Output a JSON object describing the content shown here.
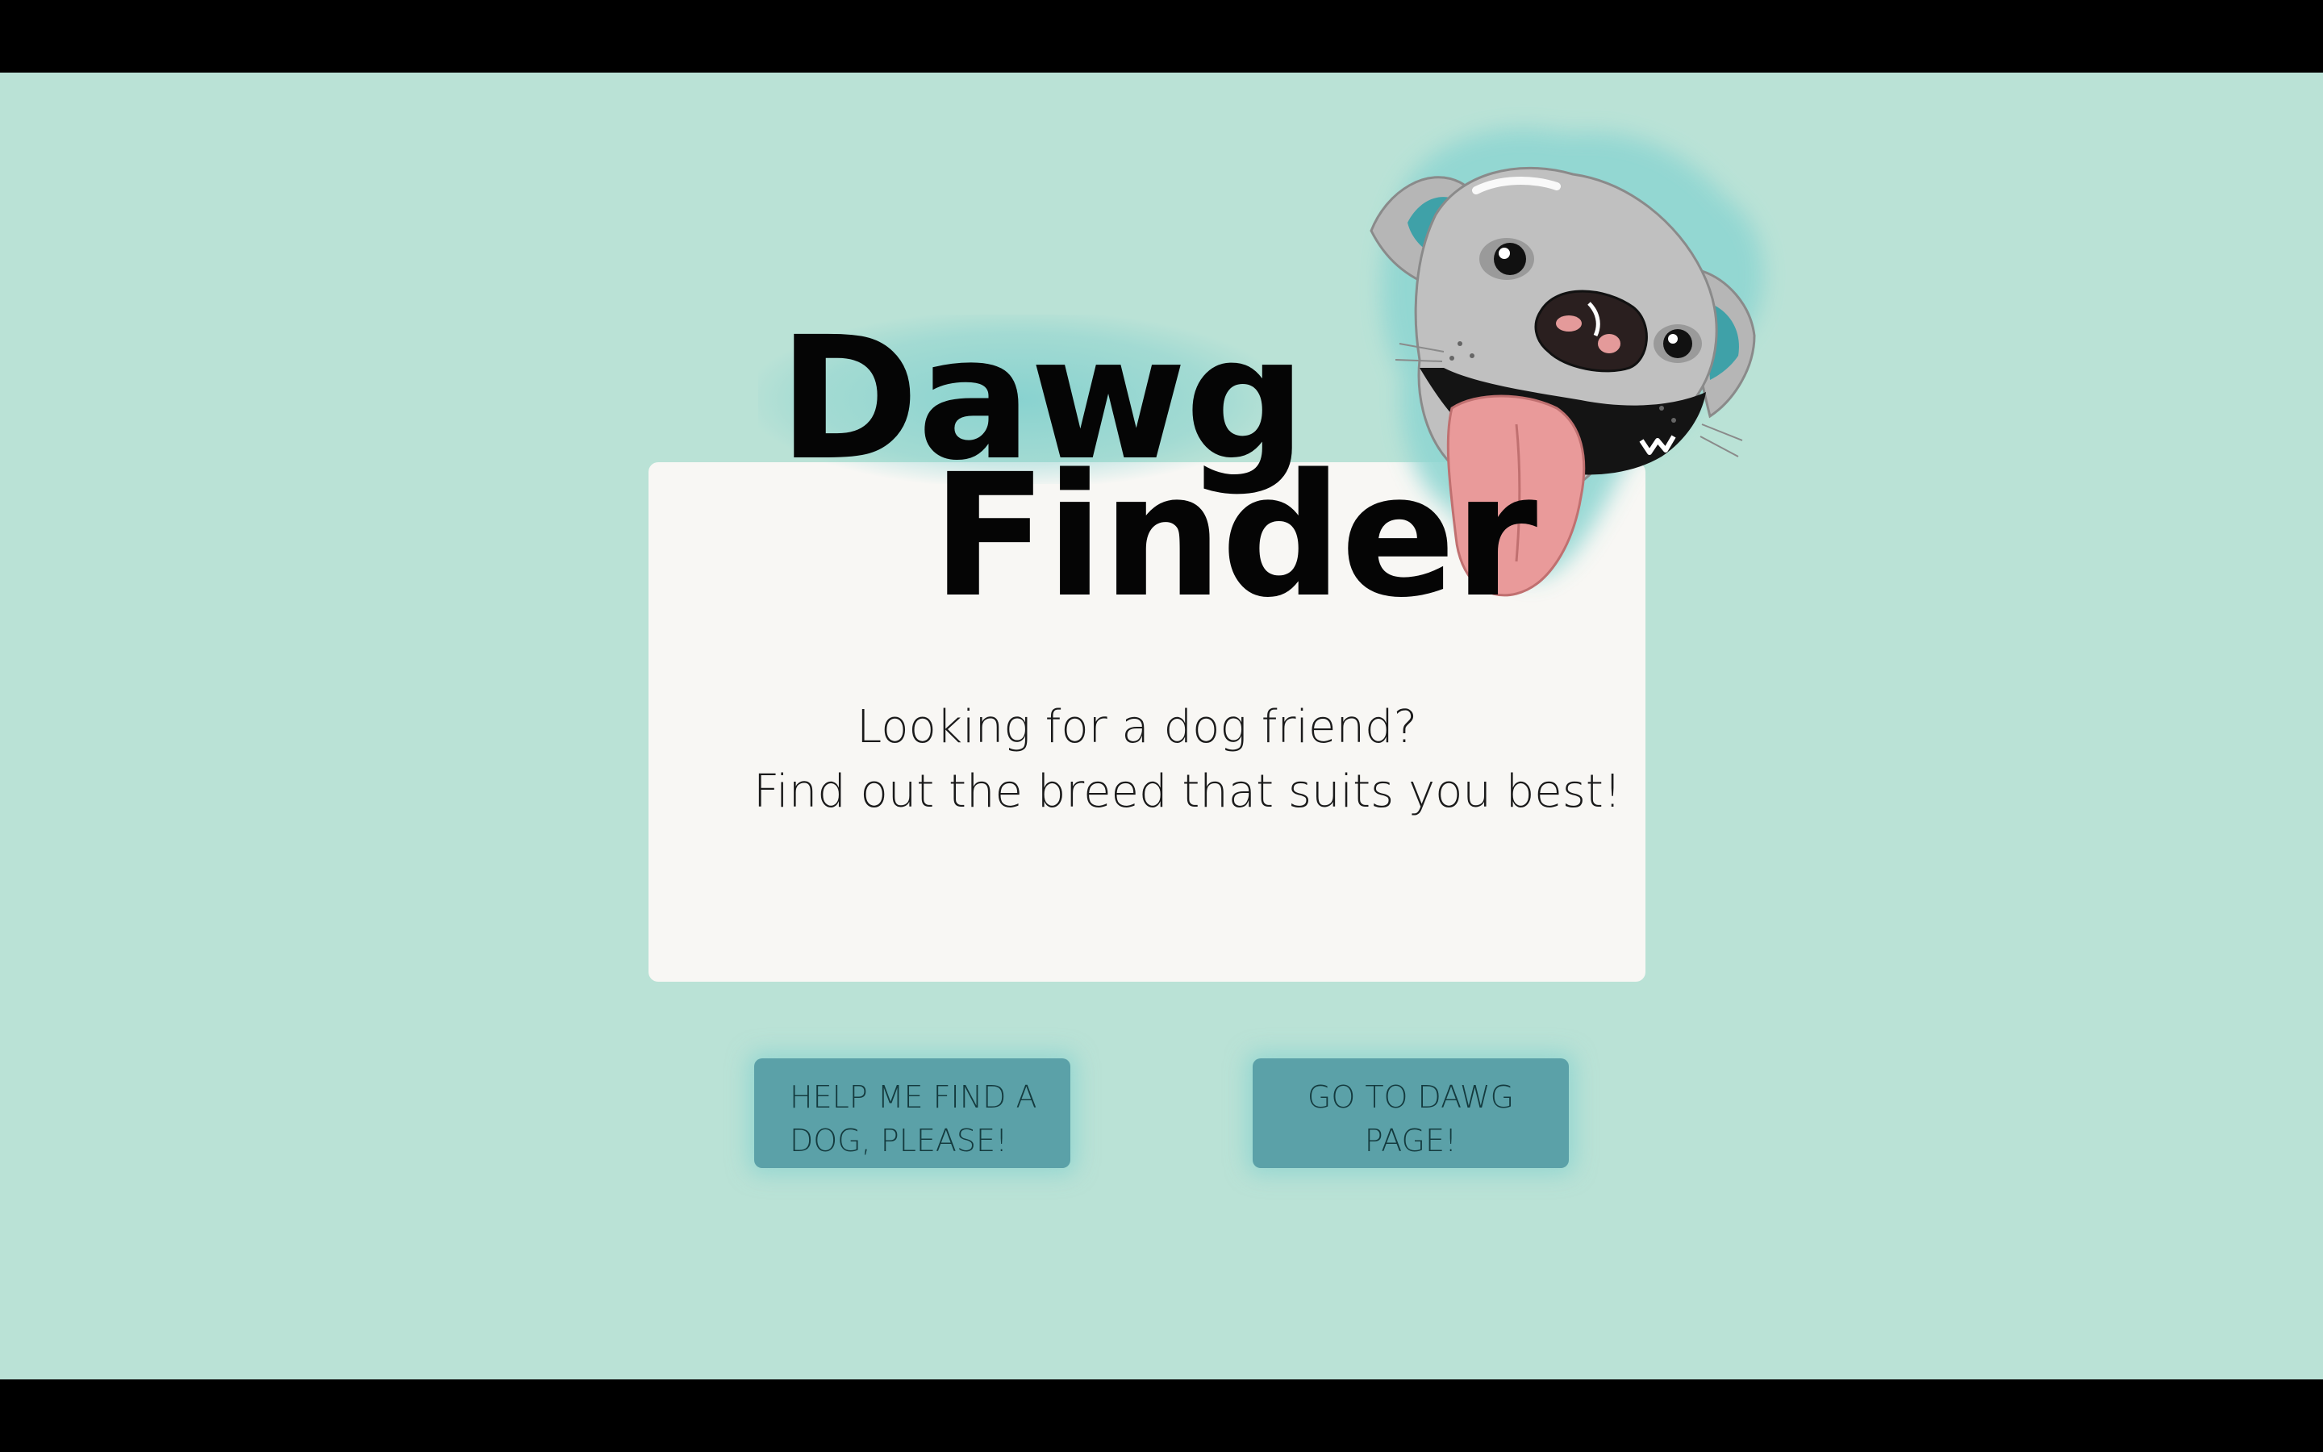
{
  "app": {
    "title_line1": "Dawg",
    "title_line2": "Finder"
  },
  "hero": {
    "tagline_line1": "Looking for a dog friend?",
    "tagline_line2": "Find out the breed that suits you best!"
  },
  "buttons": {
    "find_dog": {
      "line1": "HELP ME FIND A",
      "line2": "DOG, PLEASE!"
    },
    "dawg_page": {
      "line1": "GO TO DAWG",
      "line2": "PAGE!"
    }
  },
  "illustration": {
    "icon": "dog-head-illustration"
  },
  "colors": {
    "background": "#bae2d6",
    "card": "#f8f7f4",
    "button": "#5ba1a8",
    "title": "#050505",
    "accent_glow": "#78cdcd"
  }
}
